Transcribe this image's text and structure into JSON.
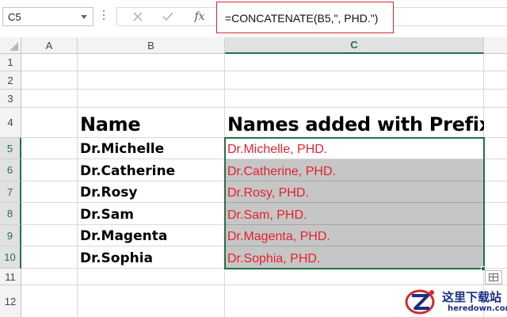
{
  "formula_bar": {
    "name_box": "C5",
    "cancel_icon": "close-icon",
    "enter_icon": "check-icon",
    "function_label": "fx",
    "formula": "=CONCATENATE(B5,\", PHD.\")"
  },
  "columns": [
    "A",
    "B",
    "C"
  ],
  "rows": [
    "1",
    "2",
    "3",
    "4",
    "5",
    "6",
    "7",
    "8",
    "9",
    "10",
    "11",
    "12"
  ],
  "headers": {
    "name": "Name",
    "result": "Names added with Prefix"
  },
  "names": [
    "Dr.Michelle",
    "Dr.Catherine",
    "Dr.Rosy",
    "Dr.Sam",
    "Dr.Magenta",
    "Dr.Sophia"
  ],
  "results": [
    "Dr.Michelle, PHD.",
    "Dr.Catherine, PHD.",
    "Dr.Rosy, PHD.",
    "Dr.Sam, PHD.",
    "Dr.Magenta, PHD.",
    "Dr.Sophia, PHD."
  ],
  "colors": {
    "accent_green": "#217346",
    "result_red": "#e2232e",
    "selection_gray": "#c6c6c6"
  },
  "watermark": {
    "cn": "这里下载站",
    "en": "heredown.com"
  }
}
